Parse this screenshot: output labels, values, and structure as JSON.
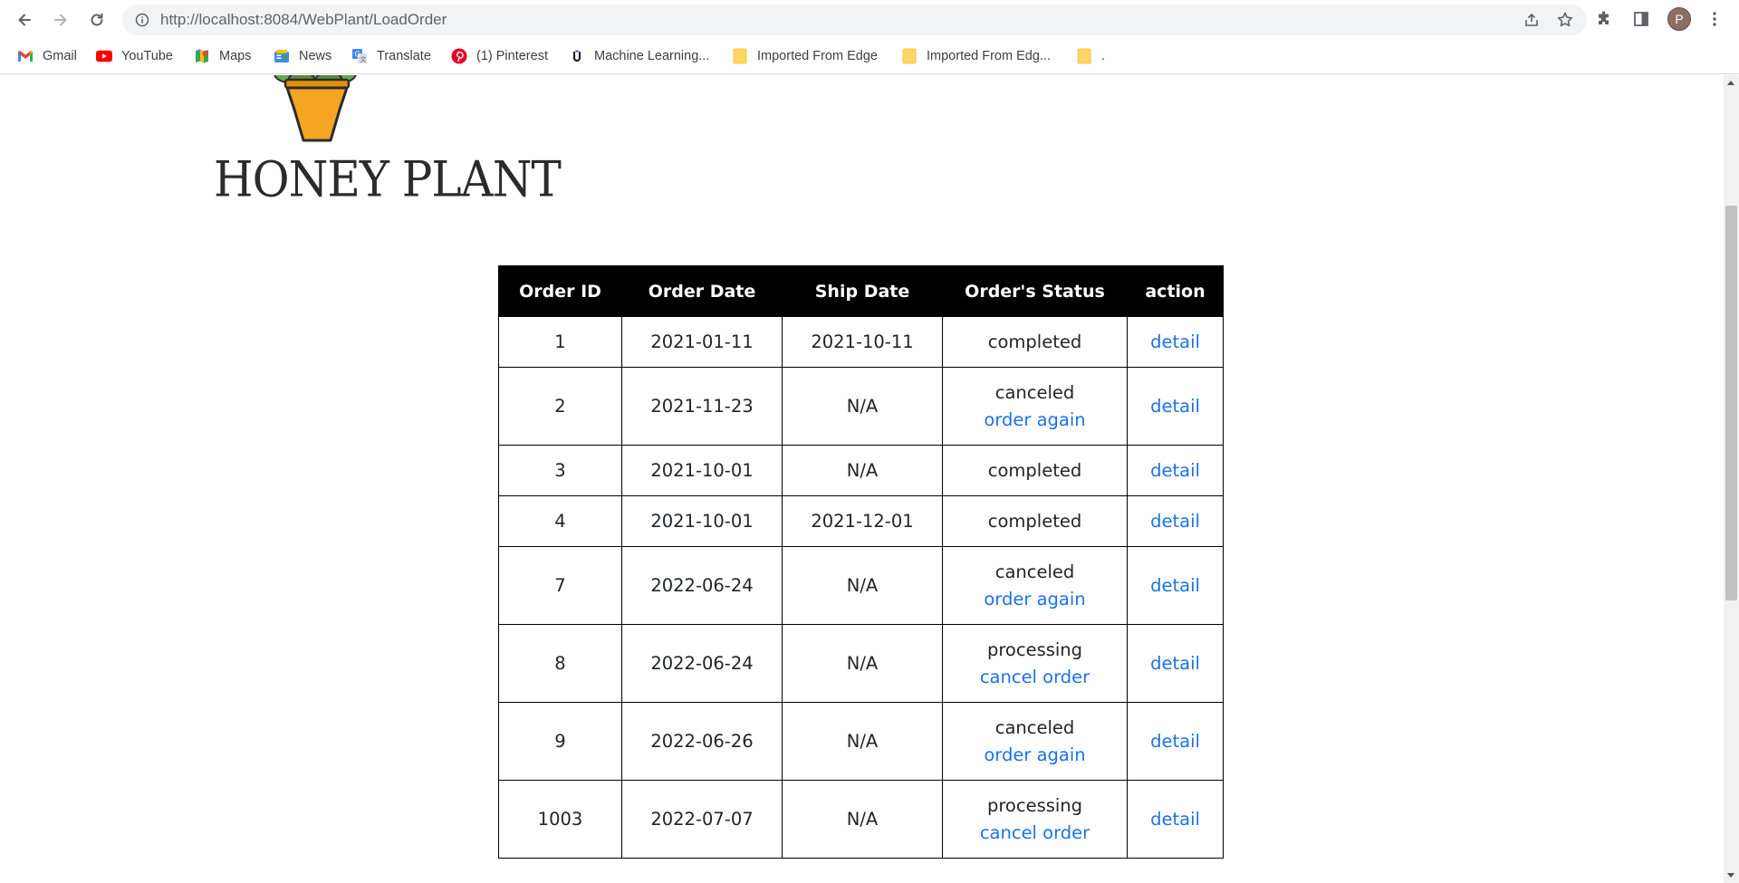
{
  "browser": {
    "url": "http://localhost:8084/WebPlant/LoadOrder",
    "avatar_letter": "P",
    "bookmarks": [
      {
        "label": "Gmail",
        "icon": "gmail-icon"
      },
      {
        "label": "YouTube",
        "icon": "youtube-icon"
      },
      {
        "label": "Maps",
        "icon": "maps-icon"
      },
      {
        "label": "News",
        "icon": "news-icon"
      },
      {
        "label": "Translate",
        "icon": "translate-icon"
      },
      {
        "label": "(1) Pinterest",
        "icon": "pinterest-icon"
      },
      {
        "label": "Machine Learning...",
        "icon": "machine-learning-icon"
      },
      {
        "label": "Imported From Edge",
        "icon": "folder-icon"
      },
      {
        "label": "Imported From Edg...",
        "icon": "folder-icon"
      },
      {
        "label": ".",
        "icon": "folder-icon"
      }
    ]
  },
  "page": {
    "logo_text": "HONEY PLANT",
    "table": {
      "headers": [
        "Order ID",
        "Order Date",
        "Ship Date",
        "Order's Status",
        "action"
      ],
      "rows": [
        {
          "id": "1",
          "order_date": "2021-01-11",
          "ship_date": "2021-10-11",
          "status": "completed",
          "status_action": "",
          "action": "detail"
        },
        {
          "id": "2",
          "order_date": "2021-11-23",
          "ship_date": "N/A",
          "status": "canceled",
          "status_action": "order again",
          "action": "detail"
        },
        {
          "id": "3",
          "order_date": "2021-10-01",
          "ship_date": "N/A",
          "status": "completed",
          "status_action": "",
          "action": "detail"
        },
        {
          "id": "4",
          "order_date": "2021-10-01",
          "ship_date": "2021-12-01",
          "status": "completed",
          "status_action": "",
          "action": "detail"
        },
        {
          "id": "7",
          "order_date": "2022-06-24",
          "ship_date": "N/A",
          "status": "canceled",
          "status_action": "order again",
          "action": "detail"
        },
        {
          "id": "8",
          "order_date": "2022-06-24",
          "ship_date": "N/A",
          "status": "processing",
          "status_action": "cancel order",
          "action": "detail"
        },
        {
          "id": "9",
          "order_date": "2022-06-26",
          "ship_date": "N/A",
          "status": "canceled",
          "status_action": "order again",
          "action": "detail"
        },
        {
          "id": "1003",
          "order_date": "2022-07-07",
          "ship_date": "N/A",
          "status": "processing",
          "status_action": "cancel order",
          "action": "detail"
        }
      ]
    }
  },
  "colors": {
    "link": "#1a73e8",
    "header_bg": "#000000",
    "logo_pot": "#f5a623",
    "logo_leaves": "#5a8f3d"
  }
}
